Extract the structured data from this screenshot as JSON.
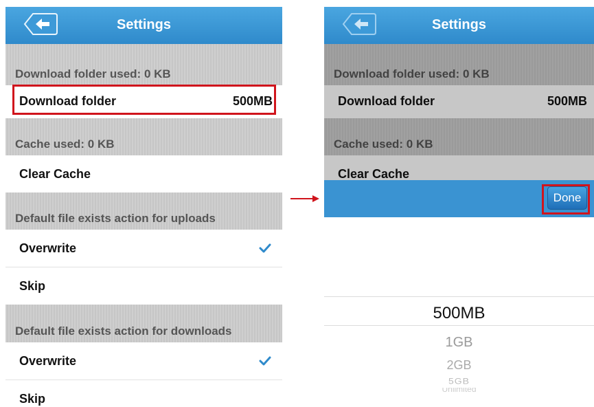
{
  "left_screen": {
    "title": "Settings",
    "sections": {
      "download": "Download folder used: 0 KB",
      "cache": "Cache used: 0 KB",
      "uploads": "Default file exists action for uploads",
      "downloads": "Default file exists action for downloads"
    },
    "rows": {
      "download_folder": {
        "label": "Download folder",
        "value": "500MB"
      },
      "clear_cache": "Clear Cache",
      "uploads_overwrite": "Overwrite",
      "uploads_skip": "Skip",
      "downloads_overwrite": "Overwrite",
      "downloads_skip": "Skip"
    }
  },
  "right_screen": {
    "title": "Settings",
    "sections": {
      "download": "Download folder used: 0 KB",
      "cache": "Cache used: 0 KB"
    },
    "rows": {
      "download_folder": {
        "label": "Download folder",
        "value": "500MB"
      },
      "clear_cache": "Clear Cache"
    },
    "toolbar": {
      "done_label": "Done"
    },
    "picker": {
      "options": [
        "500MB",
        "1GB",
        "2GB",
        "5GB",
        "Unlimited"
      ],
      "selected": "500MB"
    }
  },
  "colors": {
    "accent": "#3a93d2",
    "highlight": "#d0141c",
    "check": "#2f8acb"
  },
  "icons": [
    "back-arrow-icon",
    "checkmark-icon",
    "right-arrow-icon"
  ]
}
